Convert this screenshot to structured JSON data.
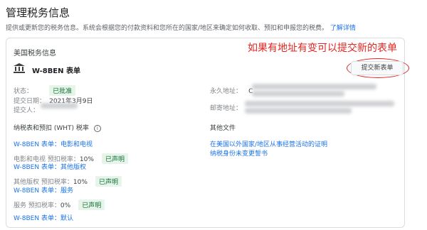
{
  "page": {
    "title": "管理税务信息",
    "description": "提供或更新您的税务信息。系统会根据您的付款资料和您所在的国家/地区来确定如何收取、预扣和申报您的税费。",
    "learn_more": "了解详情"
  },
  "card": {
    "title": "美国税务信息",
    "annotation": "如果有地址有变可以提交新的表单",
    "form_name": "W-8BEN 表单",
    "submit_button": "提交新表单",
    "status_label": "状态：",
    "status_value": "已批准",
    "submit_date_label": "提交日期：",
    "submit_date_value": "2021年3月9日",
    "submitter_label": "提交人：",
    "permanent_address_label": "永久地址：",
    "permanent_address_prefix": "C",
    "mailing_address_label": "邮寄地址："
  },
  "withholding": {
    "section_title": "纳税表和预扣 (WHT) 税率",
    "items": [
      {
        "link": "W-8BEN 表单：电影和电视",
        "rate_label": "电影和电视 预扣税率：",
        "rate": "10%",
        "badge": "已声明"
      },
      {
        "link": "W-8BEN 表单：其他版权",
        "rate_label": "其他版权 预扣税率：",
        "rate": "10%",
        "badge": "已声明"
      },
      {
        "link": "W-8BEN 表单：服务",
        "rate_label": "服务 预扣税率：",
        "rate": "0%",
        "badge": "已声明"
      },
      {
        "link": "W-8BEN 表单：默认"
      }
    ]
  },
  "other_docs": {
    "section_title": "其他文件",
    "links": [
      "在美国以外国家/地区从事经营活动的证明",
      "纳税身份未变更誓书"
    ]
  },
  "colors": {
    "link": "#1a73e8",
    "approved_bg": "#e6f4ea",
    "approved_text": "#137333",
    "annotation_red": "#e52420"
  }
}
